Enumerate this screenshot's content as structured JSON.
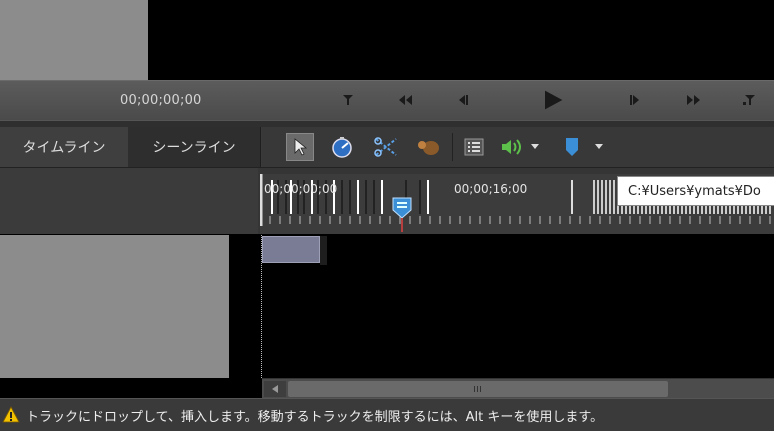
{
  "transport": {
    "timecode": "00;00;00;00",
    "buttons": [
      "go-to-start",
      "step-back-fast",
      "previous-frame",
      "play",
      "next-frame",
      "step-forward-fast",
      "go-to-end"
    ]
  },
  "tabs": {
    "timeline": "タイムライン",
    "sceneline": "シーンライン"
  },
  "toolbar": {
    "tools": [
      "select-arrow-icon",
      "stretch-speed-icon",
      "split-scissors-icon",
      "magnet-icon",
      "list-icon",
      "volume-icon",
      "marker-icon"
    ]
  },
  "ruler": {
    "tc_start": "00;00;00;00",
    "tc_mid": "00;00;16;00"
  },
  "tooltip": {
    "text": "C:¥Users¥ymats¥Do"
  },
  "status": {
    "message": "トラックにドロップして、挿入します。移動するトラックを制限するには、Alt キーを使用します。"
  },
  "colors": {
    "accent_blue": "#1f4f86",
    "warning_yellow": "#f2c200",
    "clip": "#7a7c96",
    "marker": "#3a8fd6"
  }
}
